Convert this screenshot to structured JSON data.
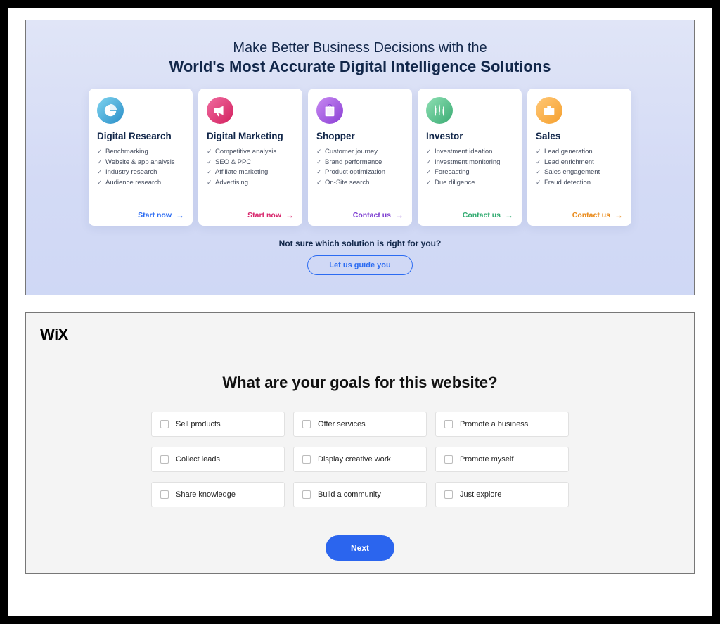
{
  "panel1": {
    "heading_line1": "Make Better Business Decisions with the",
    "heading_line2": "World's Most Accurate Digital Intelligence Solutions",
    "cards": [
      {
        "title": "Digital Research",
        "items": [
          "Benchmarking",
          "Website & app analysis",
          "Industry research",
          "Audience research"
        ],
        "cta": "Start now",
        "cta_class": "cta-blue",
        "icon_class": "icon-blue",
        "icon_name": "pie-chart-icon"
      },
      {
        "title": "Digital Marketing",
        "items": [
          "Competitive analysis",
          "SEO & PPC",
          "Affiliate marketing",
          "Advertising"
        ],
        "cta": "Start now",
        "cta_class": "cta-pink",
        "icon_class": "icon-pink",
        "icon_name": "megaphone-icon"
      },
      {
        "title": "Shopper",
        "items": [
          "Customer journey",
          "Brand performance",
          "Product optimization",
          "On-Site search"
        ],
        "cta": "Contact us",
        "cta_class": "cta-purple",
        "icon_class": "icon-purple",
        "icon_name": "shopping-bag-icon"
      },
      {
        "title": "Investor",
        "items": [
          "Investment ideation",
          "Investment monitoring",
          "Forecasting",
          "Due diligence"
        ],
        "cta": "Contact us",
        "cta_class": "cta-green",
        "icon_class": "icon-green",
        "icon_name": "candlestick-chart-icon"
      },
      {
        "title": "Sales",
        "items": [
          "Lead generation",
          "Lead enrichment",
          "Sales engagement",
          "Fraud detection"
        ],
        "cta": "Contact us",
        "cta_class": "cta-orange",
        "icon_class": "icon-orange",
        "icon_name": "briefcase-icon"
      }
    ],
    "footer_text": "Not sure which solution is right for you?",
    "guide_button": "Let us guide you"
  },
  "panel2": {
    "logo": "WiX",
    "title": "What are your goals for this website?",
    "goals": [
      "Sell products",
      "Offer services",
      "Promote a business",
      "Collect leads",
      "Display creative work",
      "Promote myself",
      "Share knowledge",
      "Build a community",
      "Just explore"
    ],
    "next_button": "Next"
  }
}
